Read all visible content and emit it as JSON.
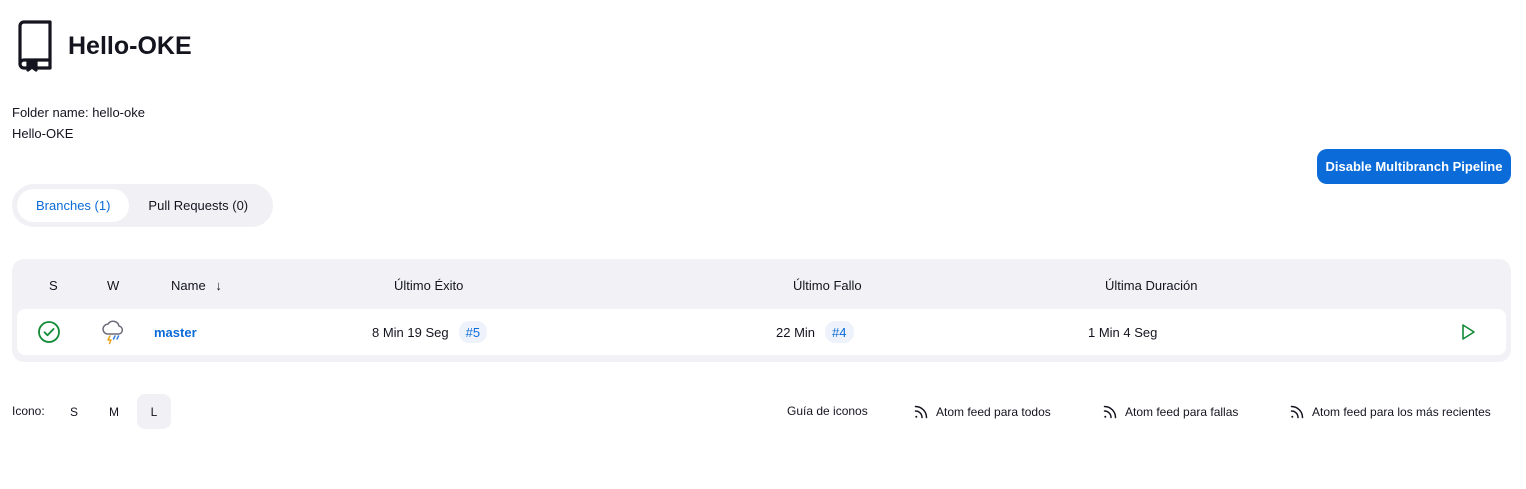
{
  "header": {
    "title": "Hello-OKE",
    "icon": "book-bookmark-icon"
  },
  "description": {
    "folder_name": "Folder name: hello-oke",
    "display_name": "Hello-OKE"
  },
  "actions": {
    "disable_label": "Disable Multibranch Pipeline",
    "accent_color": "#0b6bd8"
  },
  "tabs": [
    {
      "label": "Branches (1)",
      "active": true
    },
    {
      "label": "Pull Requests (0)",
      "active": false
    }
  ],
  "table": {
    "columns": {
      "s": "S",
      "w": "W",
      "name": "Name",
      "sort_indicator": "↓",
      "last_success": "Último Éxito",
      "last_failure": "Último Fallo",
      "last_duration": "Última Duración"
    },
    "rows": [
      {
        "status_icon": "success-check-icon",
        "status_color": "#138a36",
        "weather_icon": "storm-cloud-icon",
        "name": "master",
        "last_success": "8 Min 19 Seg",
        "last_success_build": "#5",
        "last_failure": "22 Min",
        "last_failure_build": "#4",
        "last_duration": "1 Min 4 Seg",
        "run_icon": "play-icon"
      }
    ]
  },
  "footer": {
    "icon_label": "Icono:",
    "sizes": [
      {
        "label": "S",
        "active": false
      },
      {
        "label": "M",
        "active": false
      },
      {
        "label": "L",
        "active": true
      }
    ],
    "legend_link": "Guía de iconos",
    "feeds": [
      {
        "label": "Atom feed para todos",
        "icon": "rss-icon"
      },
      {
        "label": "Atom feed para fallas",
        "icon": "rss-icon"
      },
      {
        "label": "Atom feed para los más recientes",
        "icon": "rss-icon"
      }
    ]
  }
}
